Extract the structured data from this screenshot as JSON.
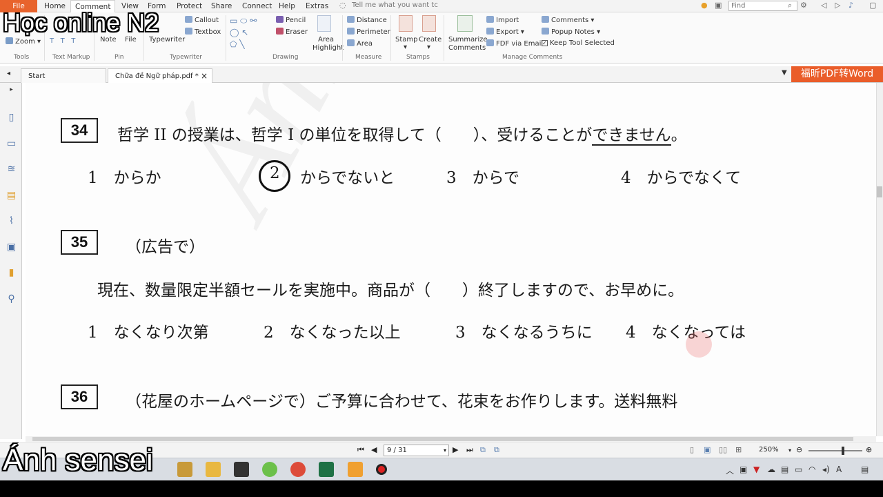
{
  "ribbon_tabs": [
    "File",
    "Home",
    "Comment",
    "View",
    "Form",
    "Protect",
    "Share",
    "Connect",
    "Help",
    "Extras"
  ],
  "tellme": "Tell me what you want tc",
  "find_placeholder": "Find",
  "ribbon": {
    "zoom": "Zoom",
    "note": "Note",
    "file": "File",
    "typewriter": "Typewriter",
    "callout": "Callout",
    "textbox": "Textbox",
    "pencil": "Pencil",
    "eraser": "Eraser",
    "area_highlight_1": "Area",
    "area_highlight_2": "Highlight",
    "distance": "Distance",
    "perimeter": "Perimeter",
    "area": "Area",
    "stamp": "Stamp",
    "create": "Create",
    "summarize_1": "Summarize",
    "summarize_2": "Comments",
    "import": "Import",
    "export": "Export",
    "fdf_email": "FDF via Email",
    "comments": "Comments",
    "popup_notes": "Popup Notes",
    "keep_tool": "Keep Tool Selected",
    "groups": {
      "tools": "Tools",
      "text_markup": "Text Markup",
      "pin": "Pin",
      "typewriter": "Typewriter",
      "drawing": "Drawing",
      "measure": "Measure",
      "stamps": "Stamps",
      "manage_comments": "Manage Comments"
    }
  },
  "doc_tabs": {
    "start": "Start",
    "file": "Chữa đề Ngữ pháp.pdf *",
    "close": "×"
  },
  "ad_banner": "福昕PDF转Word",
  "document": {
    "q34": {
      "num": "34",
      "text_a": "哲学 II の授業は、哲学 I の単位を取得して（　　）、受けることが",
      "text_b": "できません",
      "text_c": "。",
      "opt1": "1　からか",
      "opt2_num": "2",
      "opt2": "からでないと",
      "opt3": "3　からで",
      "opt4": "4　からでなくて"
    },
    "q35": {
      "num": "35",
      "intro": "（広告で）",
      "text": "現在、数量限定半額セールを実施中。商品が（　　）終了しますので、お早めに。",
      "opt1": "1　なくなり次第",
      "opt2": "2　なくなった以上",
      "opt3": "3　なくなるうちに",
      "opt4": "4　なくなっては"
    },
    "q36": {
      "num": "36",
      "text": "（花屋のホームページで）ご予算に合わせて、花束をお作りします。送料無料"
    }
  },
  "status": {
    "page": "9 / 31",
    "zoom": "250%"
  },
  "overlay": {
    "top_left": "Học online N2",
    "bottom_left": "Ánh sensei"
  }
}
